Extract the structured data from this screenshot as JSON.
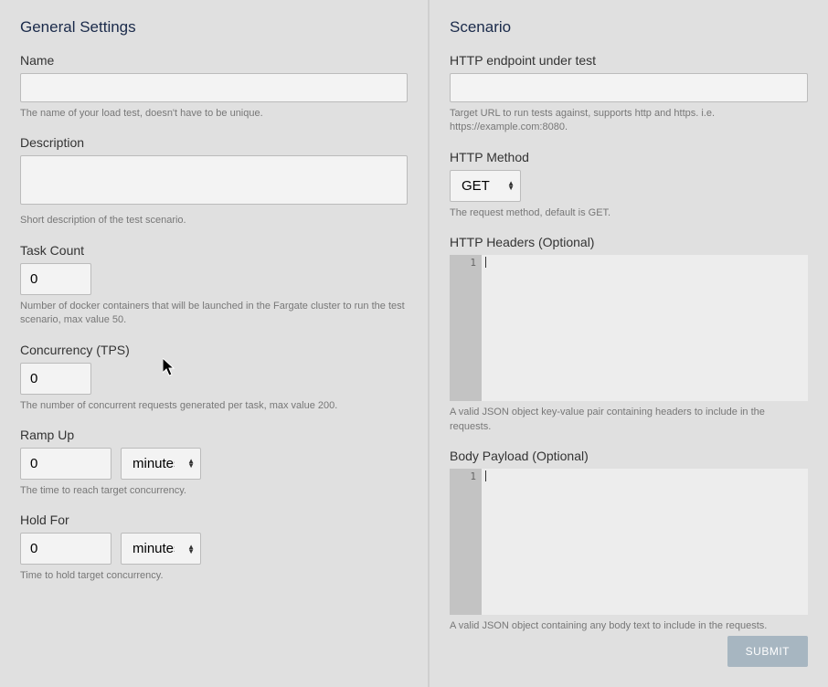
{
  "general": {
    "title": "General Settings",
    "name": {
      "label": "Name",
      "value": "",
      "help": "The name of your load test, doesn't have to be unique."
    },
    "description": {
      "label": "Description",
      "value": "",
      "help": "Short description of the test scenario."
    },
    "task_count": {
      "label": "Task Count",
      "value": "0",
      "help": "Number of docker containers that will be launched in the Fargate cluster to run the test scenario, max value 50."
    },
    "concurrency": {
      "label": "Concurrency (TPS)",
      "value": "0",
      "help": "The number of concurrent requests generated per task, max value 200."
    },
    "ramp_up": {
      "label": "Ramp Up",
      "value": "0",
      "unit": "minutes",
      "help": "The time to reach target concurrency."
    },
    "hold_for": {
      "label": "Hold For",
      "value": "0",
      "unit": "minutes",
      "help": "Time to hold target concurrency."
    }
  },
  "scenario": {
    "title": "Scenario",
    "endpoint": {
      "label": "HTTP endpoint under test",
      "value": "",
      "help": "Target URL to run tests against, supports http and https. i.e. https://example.com:8080."
    },
    "method": {
      "label": "HTTP Method",
      "value": "GET",
      "help": "The request method, default is GET."
    },
    "headers": {
      "label": "HTTP Headers (Optional)",
      "line_number": "1",
      "help": "A valid JSON object key-value pair containing headers to include in the requests."
    },
    "body": {
      "label": "Body Payload (Optional)",
      "line_number": "1",
      "help": "A valid JSON object containing any body text to include in the requests."
    },
    "submit_label": "SUBMIT"
  }
}
